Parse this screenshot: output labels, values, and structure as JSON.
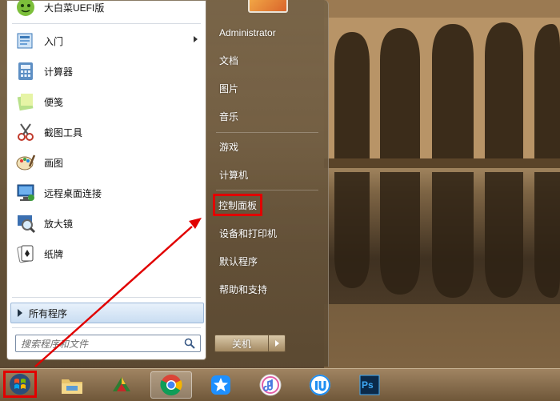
{
  "start_menu": {
    "pinned_top": {
      "label": "大白菜UEFI版",
      "icon": "cabbage-icon"
    },
    "programs": [
      {
        "label": "入门",
        "icon": "getting-started-icon",
        "has_submenu": true
      },
      {
        "label": "计算器",
        "icon": "calculator-icon",
        "has_submenu": false
      },
      {
        "label": "便笺",
        "icon": "sticky-notes-icon",
        "has_submenu": false
      },
      {
        "label": "截图工具",
        "icon": "snipping-tool-icon",
        "has_submenu": false
      },
      {
        "label": "画图",
        "icon": "paint-icon",
        "has_submenu": false
      },
      {
        "label": "远程桌面连接",
        "icon": "remote-desktop-icon",
        "has_submenu": false
      },
      {
        "label": "放大镜",
        "icon": "magnifier-icon",
        "has_submenu": false
      },
      {
        "label": "纸牌",
        "icon": "solitaire-icon",
        "has_submenu": false
      }
    ],
    "all_programs_label": "所有程序",
    "search_placeholder": "搜索程序和文件",
    "right_items": [
      {
        "label": "Administrator"
      },
      {
        "label": "文档"
      },
      {
        "label": "图片"
      },
      {
        "label": "音乐"
      },
      {
        "label": "游戏"
      },
      {
        "label": "计算机"
      },
      {
        "label": "控制面板",
        "highlighted": true
      },
      {
        "label": "设备和打印机"
      },
      {
        "label": "默认程序"
      },
      {
        "label": "帮助和支持"
      }
    ],
    "shutdown_label": "关机"
  },
  "taskbar": {
    "items": [
      {
        "name": "file-explorer",
        "icon": "folder-icon"
      },
      {
        "name": "winrar",
        "icon": "winrar-icon"
      },
      {
        "name": "chrome",
        "icon": "chrome-icon",
        "active": true
      },
      {
        "name": "pin-app",
        "icon": "star-pin-icon"
      },
      {
        "name": "itunes",
        "icon": "itunes-icon"
      },
      {
        "name": "iu-app",
        "icon": "iu-icon"
      },
      {
        "name": "photoshop",
        "icon": "photoshop-icon",
        "text": "Ps"
      }
    ]
  },
  "colors": {
    "highlight_border": "#e10000",
    "annotation_arrow": "#e10000"
  }
}
